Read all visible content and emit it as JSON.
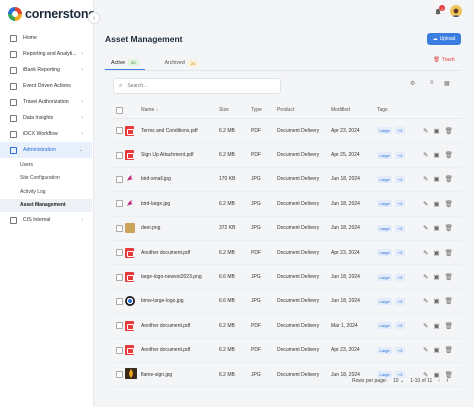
{
  "app": {
    "brand": "cornerstone",
    "notification_count": "1"
  },
  "sidebar": {
    "items": [
      {
        "label": "Home",
        "chevron": false
      },
      {
        "label": "Reporting and Analyti...",
        "chevron": true
      },
      {
        "label": "iBank Reporting",
        "chevron": true
      },
      {
        "label": "Event Driven Actions",
        "chevron": false
      },
      {
        "label": "Travel Authorization",
        "chevron": true
      },
      {
        "label": "Data Insights",
        "chevron": true
      },
      {
        "label": "iDCX Workflow",
        "chevron": true
      },
      {
        "label": "Administration",
        "chevron": true
      }
    ],
    "sub_items": [
      "Users",
      "Site Configuration",
      "Activity Log",
      "Asset Management"
    ],
    "after_items": [
      {
        "label": "CIS Internal",
        "chevron": true
      }
    ]
  },
  "header": {
    "title": "Asset Management",
    "upload_label": "Upload"
  },
  "tabs": [
    {
      "label": "Active",
      "count": "50"
    },
    {
      "label": "Archived",
      "count": "24"
    }
  ],
  "trash_label": "Trash",
  "search": {
    "placeholder": "Search..."
  },
  "table": {
    "columns": [
      "Name",
      "Size",
      "Type",
      "Product",
      "Modified",
      "Tags"
    ],
    "rows": [
      {
        "thumb": "pdf",
        "name": "Terms and Conditions.pdf",
        "size": "6.2 MB",
        "type": "PDF",
        "product": "Document Delivery",
        "modified": "Apr 23, 2024",
        "tag": "Large",
        "more": "+3"
      },
      {
        "thumb": "pdf",
        "name": "Sign Up Attachment.pdf",
        "size": "6.2 MB",
        "type": "PDF",
        "product": "Document Delivery",
        "modified": "Apr 25, 2024",
        "tag": "Large",
        "more": "+3"
      },
      {
        "thumb": "bird",
        "name": "bird-small.jpg",
        "size": "170 KB",
        "type": "JPG",
        "product": "Document Delivery",
        "modified": "Jun 18, 2024",
        "tag": "Large",
        "more": "+3"
      },
      {
        "thumb": "bird",
        "name": "bird-large.jpg",
        "size": "6.2 MB",
        "type": "JPG",
        "product": "Document Delivery",
        "modified": "Jun 18, 2024",
        "tag": "Large",
        "more": "+3"
      },
      {
        "thumb": "deer",
        "name": "deer.png",
        "size": "372 KB",
        "type": "JPG",
        "product": "Document Delivery",
        "modified": "Jun 18, 2024",
        "tag": "Large",
        "more": "+3"
      },
      {
        "thumb": "pdf",
        "name": "Another document.pdf",
        "size": "6.2 MB",
        "type": "PDF",
        "product": "Document Delivery",
        "modified": "Apr 23, 2024",
        "tag": "Large",
        "more": "+3"
      },
      {
        "thumb": "pdf",
        "name": "large-logo-newest2023.png",
        "size": "6.6 MB",
        "type": "JPG",
        "product": "Document Delivery",
        "modified": "Jun 18, 2024",
        "tag": "Large",
        "more": "+3"
      },
      {
        "thumb": "bmw",
        "name": "bmw-large-logo.jpg",
        "size": "6.6 MB",
        "type": "JPG",
        "product": "Document Delivery",
        "modified": "Jun 18, 2024",
        "tag": "Large",
        "more": "+3"
      },
      {
        "thumb": "pdf",
        "name": "Another document.pdf",
        "size": "6.2 MB",
        "type": "PDF",
        "product": "Document Delivery",
        "modified": "Mar 1, 2024",
        "tag": "Large",
        "more": "+3"
      },
      {
        "thumb": "pdf",
        "name": "Another document.pdf",
        "size": "6.2 MB",
        "type": "PDF",
        "product": "Document Delivery",
        "modified": "Apr 23, 2024",
        "tag": "Large",
        "more": "+3"
      },
      {
        "thumb": "flame",
        "name": "flame-sign.jpg",
        "size": "6.2 MB",
        "type": "JPG",
        "product": "Document Delivery",
        "modified": "Jun 18, 2024",
        "tag": "Large",
        "more": "+3"
      }
    ]
  },
  "pagination": {
    "rows_label": "Rows per page:",
    "rows_value": "10",
    "range": "1-10 of 11"
  },
  "colors": {
    "accent": "#3b7de0",
    "danger": "#e5393a",
    "tag_bg": "#e3ecfb"
  }
}
